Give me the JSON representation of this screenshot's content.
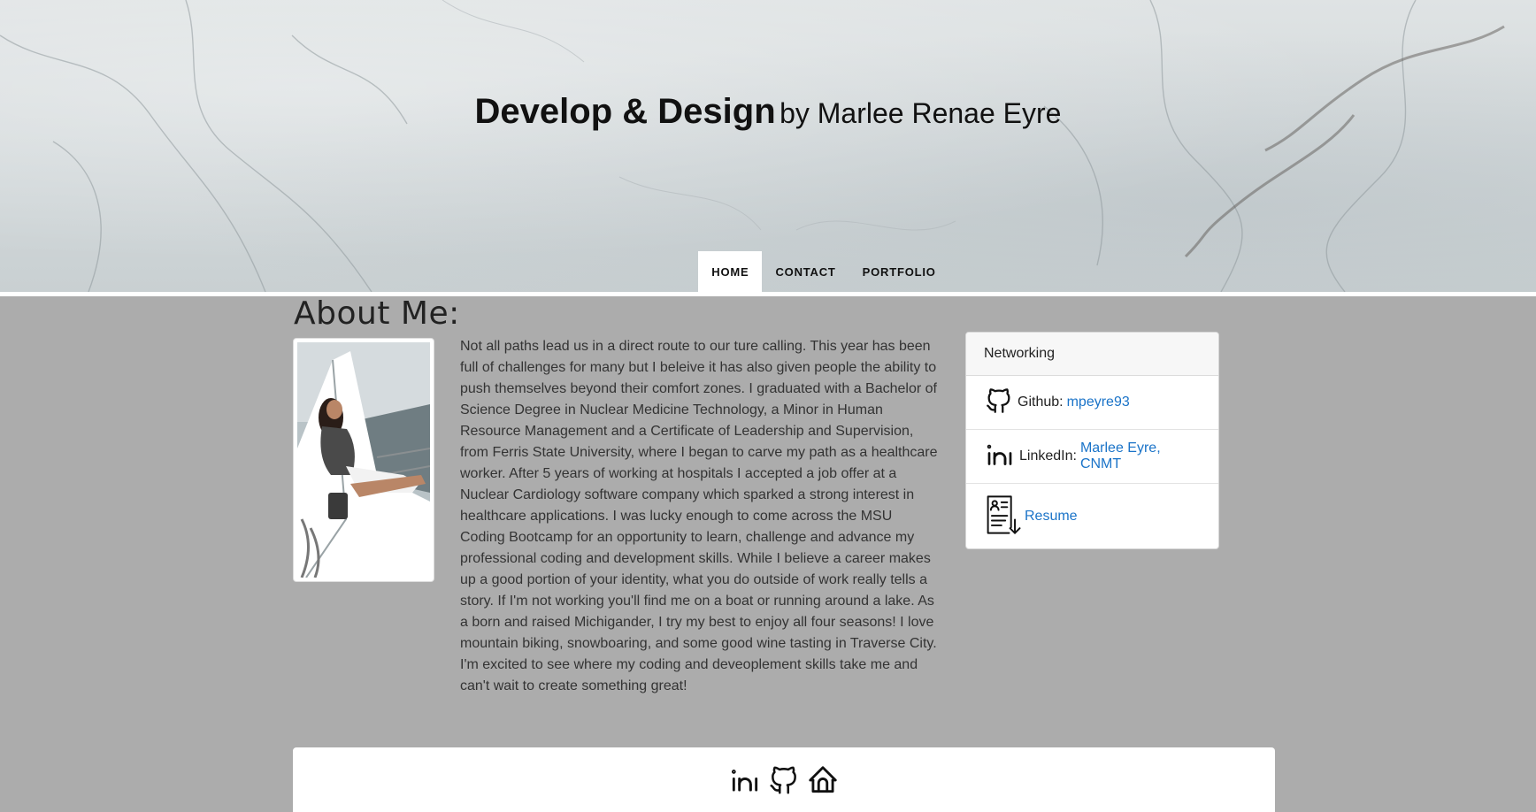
{
  "header": {
    "title": "Develop & Design",
    "subtitle": "by Marlee Renae Eyre"
  },
  "nav": {
    "items": [
      {
        "label": "HOME",
        "active": true
      },
      {
        "label": "CONTACT",
        "active": false
      },
      {
        "label": "PORTFOLIO",
        "active": false
      }
    ]
  },
  "about": {
    "heading": "About Me:",
    "bio": "Not all paths lead us in a direct route to our ture calling. This year has been full of challenges for many but I beleive it has also given people the ability to push themselves beyond their comfort zones. I graduated with a Bachelor of Science Degree in Nuclear Medicine Technology, a Minor in Human Resource Management and a Certificate of Leadership and Supervision, from Ferris State University, where I began to carve my path as a healthcare worker. After 5 years of working at hospitals I accepted a job offer at a Nuclear Cardiology software company which sparked a strong interest in healthcare applications. I was lucky enough to come across the MSU Coding Bootcamp for an opportunity to learn, challenge and advance my professional coding and development skills. While I believe a career makes up a good portion of your identity, what you do outside of work really tells a story. If I'm not working you'll find me on a boat or running around a lake. As a born and raised Michigander, I try my best to enjoy all four seasons! I love mountain biking, snowboaring, and some good wine tasting in Traverse City. I'm excited to see where my coding and deveoplement skills take me and can't wait to create something great!"
  },
  "networking": {
    "header": "Networking",
    "github_label": "Github:",
    "github_link": "mpeyre93",
    "linkedin_label": "LinkedIn:",
    "linkedin_link": "Marlee Eyre, CNMT",
    "resume_link": "Resume"
  },
  "footer": {
    "icons": [
      "linkedin-icon",
      "github-icon",
      "home-icon"
    ]
  },
  "colors": {
    "page_bg": "#acacac",
    "link": "#1a73c8",
    "card_header_bg": "#f7f7f7"
  }
}
